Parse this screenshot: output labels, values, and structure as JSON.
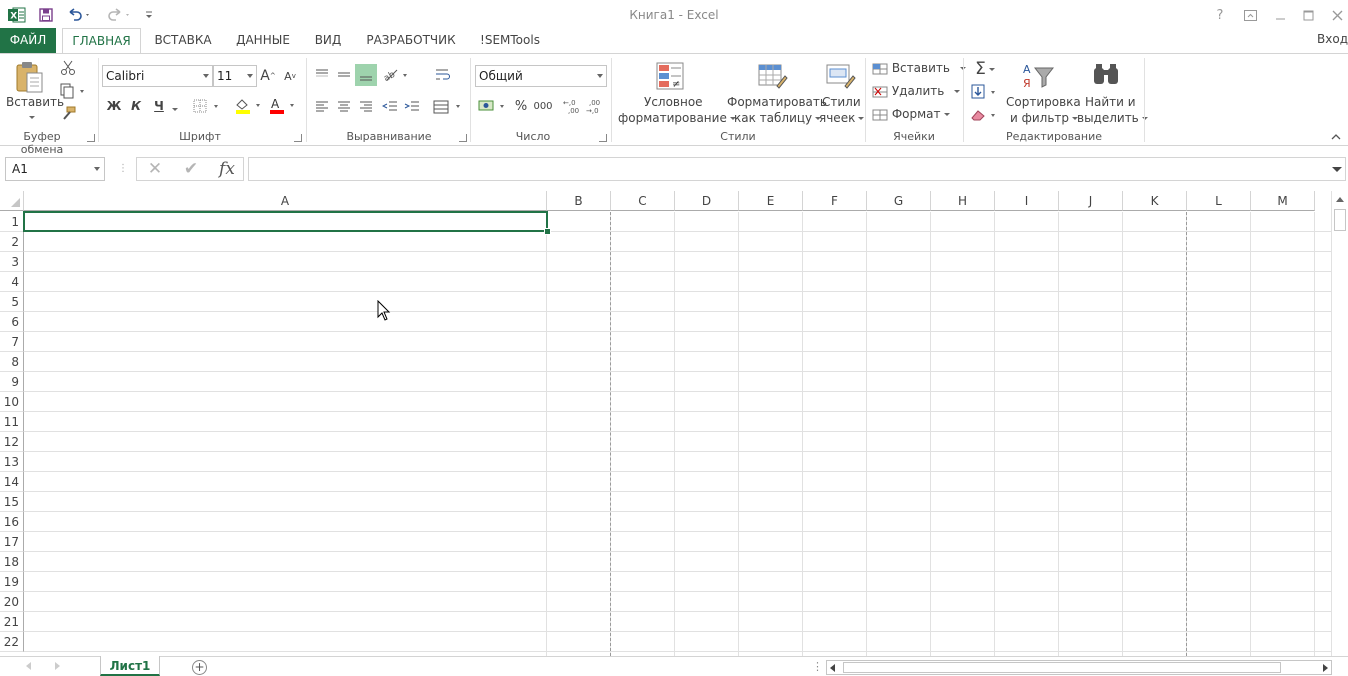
{
  "window": {
    "title": "Книга1 - Excel",
    "help": "?",
    "ribbon_display": "⊡",
    "minimize": "—",
    "maximize": "☐",
    "close": "✕"
  },
  "quick_access": {
    "app_icon": "excel-icon",
    "save": "save-icon",
    "undo": "undo-icon",
    "redo": "redo-icon",
    "customize": "customize-icon"
  },
  "menu": {
    "tabs": [
      {
        "label": "ФАЙЛ"
      },
      {
        "label": "ГЛАВНАЯ"
      },
      {
        "label": "ВСТАВКА"
      },
      {
        "label": "ДАННЫЕ"
      },
      {
        "label": "ВИД"
      },
      {
        "label": "РАЗРАБОТЧИК"
      },
      {
        "label": "!SEMTools"
      }
    ],
    "active_tab": "ГЛАВНАЯ",
    "sign_in": "Вход"
  },
  "ribbon": {
    "clipboard": {
      "label": "Буфер обмена",
      "paste": "Вставить"
    },
    "font": {
      "label": "Шрифт",
      "font_name": "Calibri",
      "font_size": "11",
      "grow": "A",
      "shrink": "A",
      "bold": "Ж",
      "italic": "К",
      "underline": "Ч",
      "highlight_color": "#ffff00",
      "font_color": "#ff0000"
    },
    "alignment": {
      "label": "Выравнивание"
    },
    "number": {
      "label": "Число",
      "format": "Общий",
      "percent": "%",
      "thousands": "000",
      "inc_decimal": ",0 ,00",
      "dec_decimal": ",00 ,0"
    },
    "styles": {
      "label": "Стили",
      "conditional_line1": "Условное",
      "conditional_line2": "форматирование",
      "format_table_line1": "Форматировать",
      "format_table_line2": "как таблицу",
      "cell_styles_line1": "Стили",
      "cell_styles_line2": "ячеек"
    },
    "cells": {
      "label": "Ячейки",
      "insert": "Вставить",
      "delete": "Удалить",
      "format": "Формат"
    },
    "editing": {
      "label": "Редактирование",
      "autosum": "Σ",
      "sort_line1": "Сортировка",
      "sort_line2": "и фильтр",
      "find_line1": "Найти и",
      "find_line2": "выделить"
    }
  },
  "formula_bar": {
    "name_box": "A1",
    "cancel": "✕",
    "enter": "✔",
    "fx": "fx",
    "value": ""
  },
  "grid": {
    "columns": [
      "A",
      "B",
      "C",
      "D",
      "E",
      "F",
      "G",
      "H",
      "I",
      "J",
      "K",
      "L",
      "M"
    ],
    "rows": [
      "1",
      "2",
      "3",
      "4",
      "5",
      "6",
      "7",
      "8",
      "9",
      "10",
      "11",
      "12",
      "13",
      "14",
      "15",
      "16",
      "17",
      "18",
      "19",
      "20",
      "21",
      "22"
    ],
    "selected_cell": "A1"
  },
  "sheets": {
    "tabs": [
      {
        "label": "Лист1"
      }
    ],
    "active": "Лист1",
    "add": "+"
  },
  "colors": {
    "accent": "#217346"
  }
}
